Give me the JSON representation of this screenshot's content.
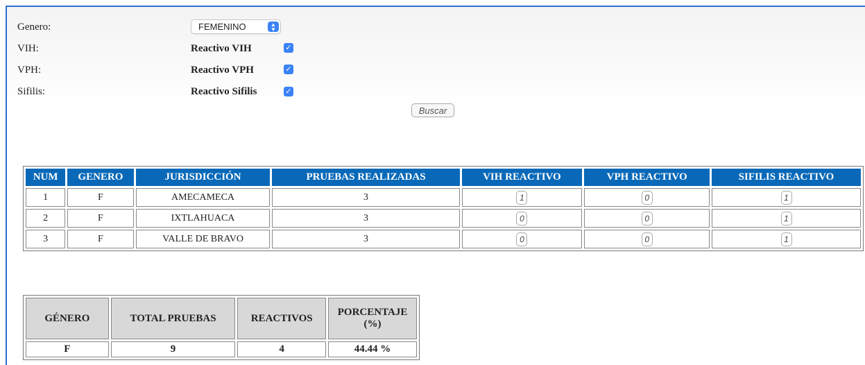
{
  "form": {
    "genero": {
      "label": "Genero:",
      "value": "FEMENINO"
    },
    "vih": {
      "label": "VIH:",
      "check_label": "Reactivo VIH",
      "checked": true
    },
    "vph": {
      "label": "VPH:",
      "check_label": "Reactivo VPH",
      "checked": true
    },
    "sifilis": {
      "label": "Sifilis:",
      "check_label": "Reactivo Sifilis",
      "checked": true
    },
    "search_button": "Buscar"
  },
  "results_table": {
    "headers": [
      "NUM",
      "GENERO",
      "JURISDICCIÓN",
      "PRUEBAS REALIZADAS",
      "VIH REACTIVO",
      "VPH REACTIVO",
      "SIFILIS REACTIVO"
    ],
    "rows": [
      {
        "num": "1",
        "genero": "F",
        "jurisdiccion": "AMECAMECA",
        "pruebas": "3",
        "vih": "1",
        "vph": "0",
        "sifilis": "1"
      },
      {
        "num": "2",
        "genero": "F",
        "jurisdiccion": "IXTLAHUACA",
        "pruebas": "3",
        "vih": "0",
        "vph": "0",
        "sifilis": "1"
      },
      {
        "num": "3",
        "genero": "F",
        "jurisdiccion": "VALLE DE BRAVO",
        "pruebas": "3",
        "vih": "0",
        "vph": "0",
        "sifilis": "1"
      }
    ]
  },
  "summary_table": {
    "headers": [
      "GÉNERO",
      "TOTAL PRUEBAS",
      "REACTIVOS",
      "PORCENTAJE",
      "(%)"
    ],
    "row": {
      "genero": "F",
      "total": "9",
      "reactivos": "4",
      "porcentaje": "44.44 %"
    }
  },
  "colors": {
    "header_blue": "#0969b8",
    "checkbox_blue": "#3b82f6",
    "frame_blue": "#2d6fd0"
  }
}
